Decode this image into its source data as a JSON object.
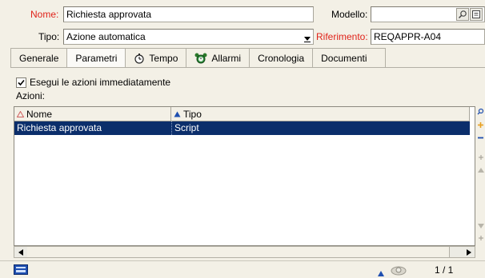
{
  "form": {
    "nome_label": "Nome:",
    "nome_value": "Richiesta approvata",
    "modello_label": "Modello:",
    "modello_value": "",
    "tipo_label": "Tipo:",
    "tipo_value": "Azione automatica",
    "riferimento_label": "Riferimento:",
    "riferimento_value": "REQAPPR-A04"
  },
  "tabs": [
    {
      "label": "Generale"
    },
    {
      "label": "Parametri"
    },
    {
      "label": "Tempo"
    },
    {
      "label": "Allarmi"
    },
    {
      "label": "Cronologia"
    },
    {
      "label": "Documenti"
    }
  ],
  "params": {
    "exec_checkbox_label": "Esegui le azioni immediatamente",
    "exec_checked": true,
    "actions_label": "Azioni:"
  },
  "list": {
    "columns": [
      {
        "label": "Nome"
      },
      {
        "label": "Tipo"
      }
    ],
    "rows": [
      {
        "nome": "Richiesta approvata",
        "tipo": "Script",
        "selected": true
      }
    ]
  },
  "status": {
    "page": "1 / 1"
  },
  "colors": {
    "label_red": "#e0231a",
    "selection": "#0b2e6b",
    "background": "#f3f0e6"
  },
  "icons": [
    "search-icon",
    "detail-icon",
    "dropdown-arrow-icon",
    "stopwatch-icon",
    "alarm-clock-icon",
    "sort-asc-icon",
    "zoom-icon",
    "add-icon",
    "remove-icon",
    "scroll-left-icon",
    "scroll-right-icon",
    "screen-icon",
    "history-icon"
  ]
}
